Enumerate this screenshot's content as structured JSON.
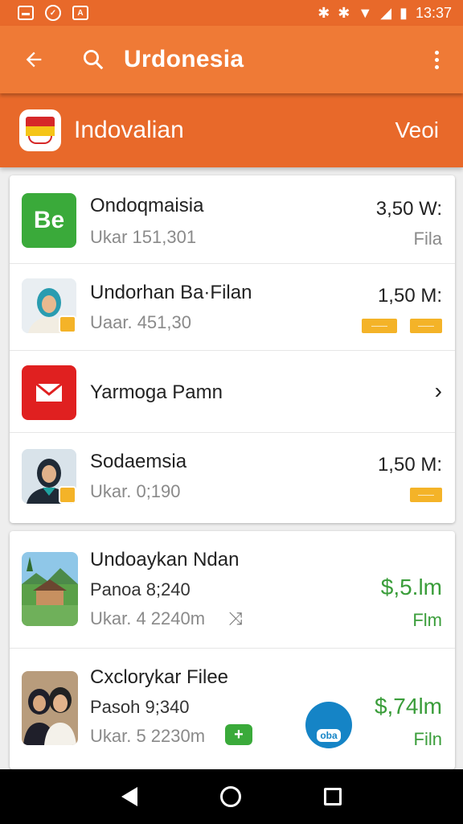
{
  "status": {
    "time": "13:37"
  },
  "app_bar": {
    "title": "Urdonesia"
  },
  "sub_bar": {
    "title": "Indovalian",
    "right": "Veoi"
  },
  "list1": [
    {
      "name": "Ondoqmaisia",
      "sub": "Ukar 151,301",
      "price": "3,50 W:",
      "unit": "Fila",
      "logo": "Be"
    },
    {
      "name": "Undorhan Ba·Filan",
      "sub": "Uaar. 451,30",
      "price": "1,50 M:",
      "tag1": "――",
      "tag2": "――"
    },
    {
      "name": "Yarmoga Pamn"
    },
    {
      "name": "Sodaemsia",
      "sub": "Ukar. 0;190",
      "price": "1,50 M:",
      "tag": "――"
    }
  ],
  "list2": [
    {
      "name": "Undoaykan Ndan",
      "sub1": "Panoa 8;240",
      "sub2": "Ukar. 4 2240m",
      "price": "$,5.lm",
      "unit": "Flm"
    },
    {
      "name": "Cxclorykar Filee",
      "sub1": "Pasoh 9;340",
      "sub2": "Ukar. 5 2230m",
      "price": "$,74lm",
      "unit": "Filn",
      "logo_text": "oba"
    }
  ]
}
